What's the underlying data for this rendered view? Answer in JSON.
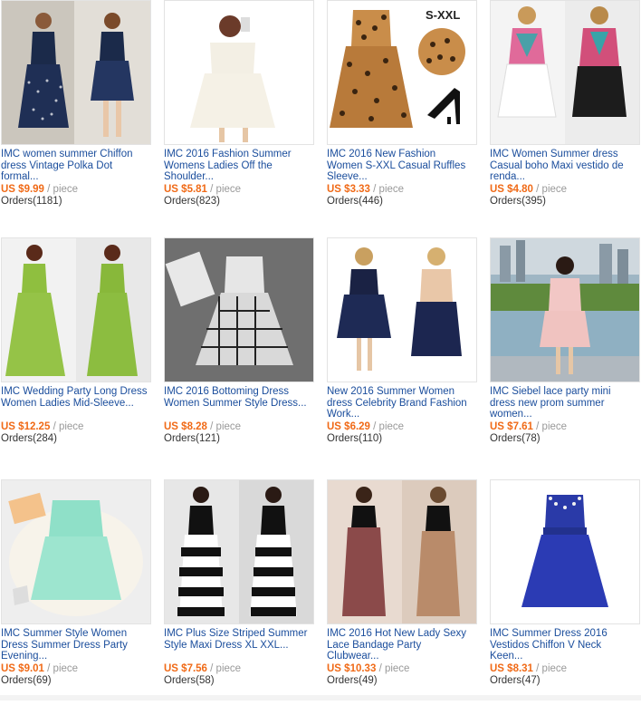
{
  "products": [
    {
      "title": "IMC women summer Chiffon dress Vintage Polka Dot formal...",
      "price": "US $9.99",
      "unit": "/ piece",
      "orders": "Orders(1181)",
      "badge": ""
    },
    {
      "title": "IMC 2016 Fashion Summer Womens Ladies Off the Shoulder...",
      "price": "US $5.81",
      "unit": "/ piece",
      "orders": "Orders(823)",
      "badge": ""
    },
    {
      "title": "IMC 2016 New Fashion Women S-XXL Casual Ruffles Sleeve...",
      "price": "US $3.33",
      "unit": "/ piece",
      "orders": "Orders(446)",
      "badge": "S-XXL"
    },
    {
      "title": "IMC Women Summer dress Casual boho Maxi vestido de renda...",
      "price": "US $4.80",
      "unit": "/ piece",
      "orders": "Orders(395)",
      "badge": ""
    },
    {
      "title": "IMC Wedding Party Long Dress Women Ladies Mid-Sleeve...",
      "price": "US $12.25",
      "unit": "/ piece",
      "orders": "Orders(284)",
      "badge": ""
    },
    {
      "title": "IMC 2016 Bottoming Dress Women Summer Style Dress...",
      "price": "US $8.28",
      "unit": "/ piece",
      "orders": "Orders(121)",
      "badge": ""
    },
    {
      "title": "New 2016 Summer Women dress Celebrity Brand Fashion Work...",
      "price": "US $6.29",
      "unit": "/ piece",
      "orders": "Orders(110)",
      "badge": ""
    },
    {
      "title": "IMC Siebel lace party mini dress new prom summer women...",
      "price": "US $7.61",
      "unit": "/ piece",
      "orders": "Orders(78)",
      "badge": ""
    },
    {
      "title": "IMC Summer Style Women Dress Summer Dress Party Evening...",
      "price": "US $9.01",
      "unit": "/ piece",
      "orders": "Orders(69)",
      "badge": ""
    },
    {
      "title": "IMC Plus Size Striped Summer Style Maxi Dress XL XXL...",
      "price": "US $7.56",
      "unit": "/ piece",
      "orders": "Orders(58)",
      "badge": ""
    },
    {
      "title": "IMC 2016 Hot New Lady Sexy Lace Bandage Party Clubwear...",
      "price": "US $10.33",
      "unit": "/ piece",
      "orders": "Orders(49)",
      "badge": ""
    },
    {
      "title": "IMC Summer Dress 2016 Vestidos Chiffon V Neck Keen...",
      "price": "US $8.31",
      "unit": "/ piece",
      "orders": "Orders(47)",
      "badge": ""
    }
  ],
  "colors": {
    "title": "#1a4d9c",
    "price": "#f06a17",
    "unit": "#999999",
    "border": "#e3e3e3"
  }
}
